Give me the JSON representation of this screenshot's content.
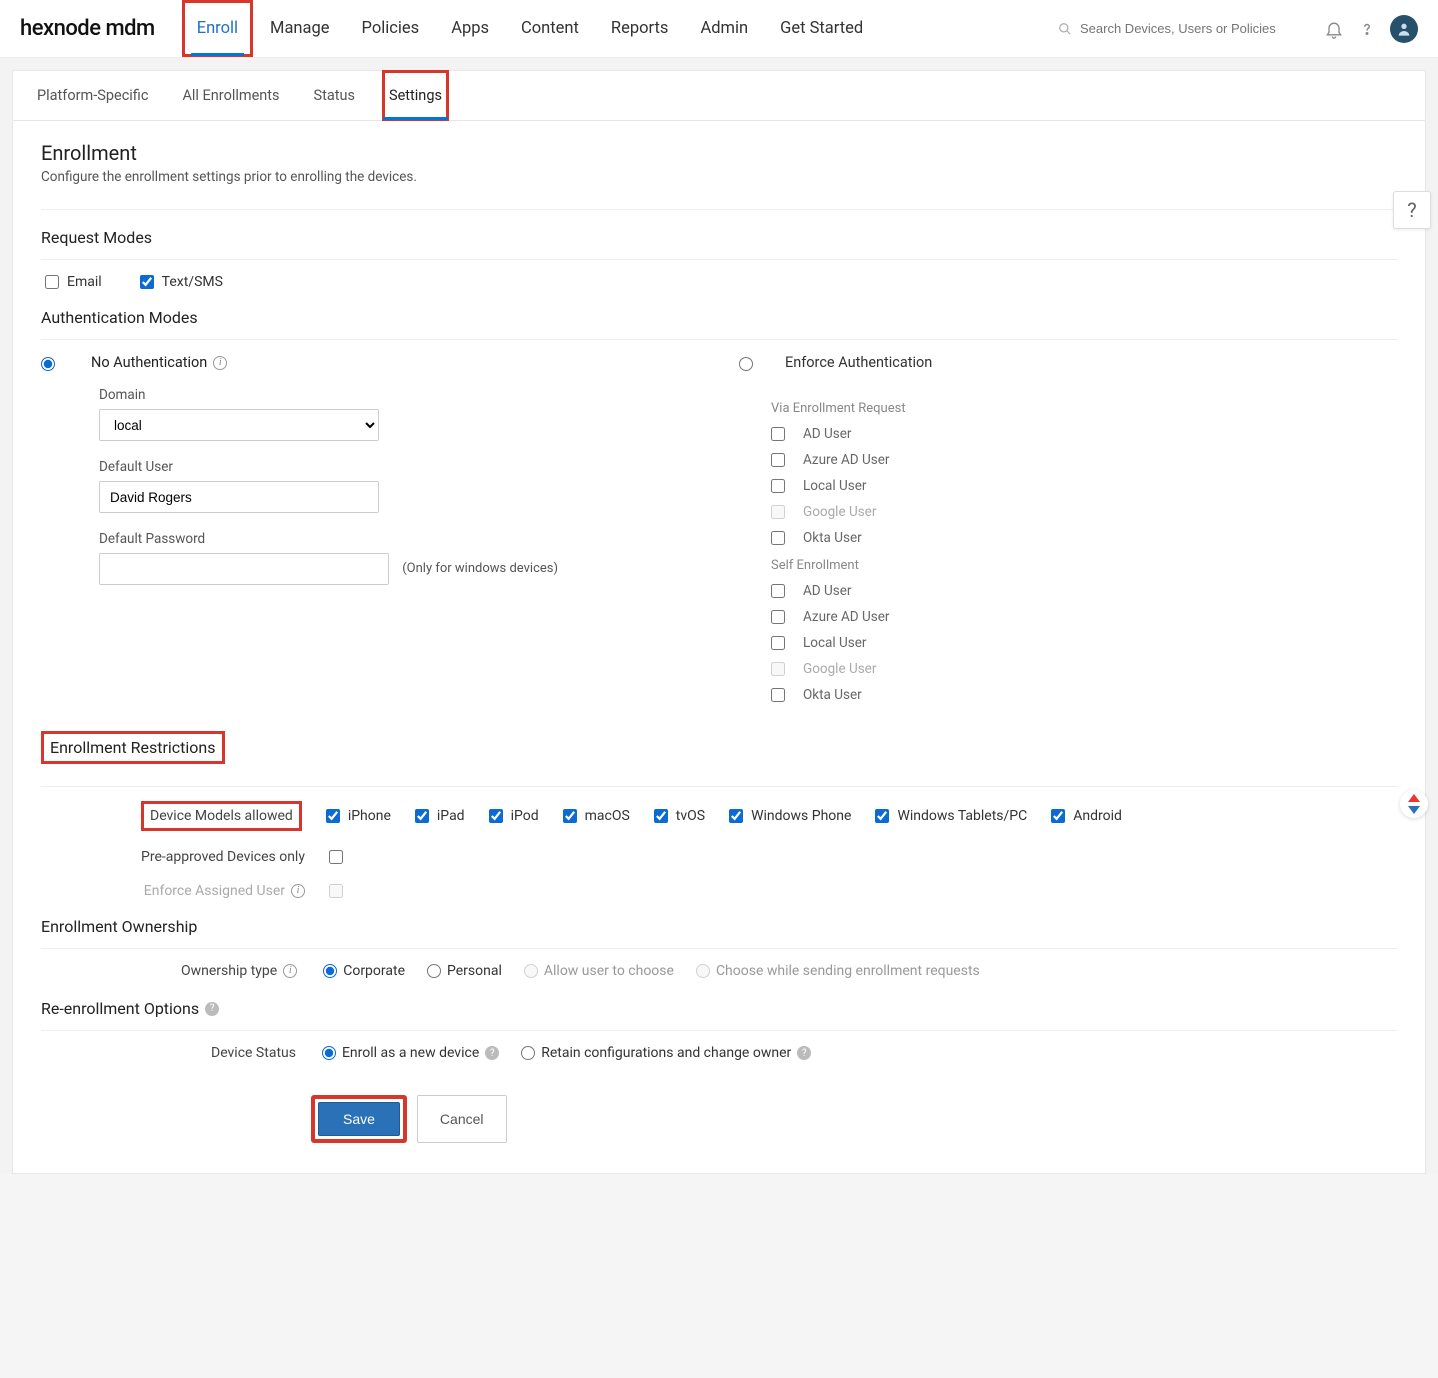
{
  "logo": "hexnode mdm",
  "top_nav": [
    "Enroll",
    "Manage",
    "Policies",
    "Apps",
    "Content",
    "Reports",
    "Admin",
    "Get Started"
  ],
  "top_nav_active_index": 0,
  "search": {
    "placeholder": "Search Devices, Users or Policies"
  },
  "sub_tabs": [
    "Platform-Specific",
    "All Enrollments",
    "Status",
    "Settings"
  ],
  "sub_tab_active_index": 3,
  "page_title": "Enrollment",
  "page_subtitle": "Configure the enrollment settings prior to enrolling the devices.",
  "sections": {
    "request_modes": {
      "title": "Request Modes",
      "options": [
        {
          "label": "Email",
          "checked": false
        },
        {
          "label": "Text/SMS",
          "checked": true
        }
      ]
    },
    "auth_modes": {
      "title": "Authentication Modes",
      "no_auth": {
        "label": "No Authentication",
        "selected": true,
        "domain": {
          "label": "Domain",
          "value": "local"
        },
        "default_user": {
          "label": "Default User",
          "value": "David Rogers"
        },
        "default_password": {
          "label": "Default Password",
          "value": "",
          "hint": "(Only for windows devices)"
        }
      },
      "enforce_auth": {
        "label": "Enforce Authentication",
        "selected": false,
        "via_label": "Via Enrollment Request",
        "via_items": [
          {
            "label": "AD User",
            "checked": false,
            "disabled": false
          },
          {
            "label": "Azure AD User",
            "checked": false,
            "disabled": false
          },
          {
            "label": "Local User",
            "checked": false,
            "disabled": false
          },
          {
            "label": "Google User",
            "checked": false,
            "disabled": true
          },
          {
            "label": "Okta User",
            "checked": false,
            "disabled": false
          }
        ],
        "self_label": "Self Enrollment",
        "self_items": [
          {
            "label": "AD User",
            "checked": false,
            "disabled": false
          },
          {
            "label": "Azure AD User",
            "checked": false,
            "disabled": false
          },
          {
            "label": "Local User",
            "checked": false,
            "disabled": false
          },
          {
            "label": "Google User",
            "checked": false,
            "disabled": true
          },
          {
            "label": "Okta User",
            "checked": false,
            "disabled": false
          }
        ]
      }
    },
    "restrictions": {
      "title": "Enrollment Restrictions",
      "device_models_label": "Device Models allowed",
      "device_models": [
        {
          "label": "iPhone",
          "checked": true
        },
        {
          "label": "iPad",
          "checked": true
        },
        {
          "label": "iPod",
          "checked": true
        },
        {
          "label": "macOS",
          "checked": true
        },
        {
          "label": "tvOS",
          "checked": true
        },
        {
          "label": "Windows Phone",
          "checked": true
        },
        {
          "label": "Windows Tablets/PC",
          "checked": true
        },
        {
          "label": "Android",
          "checked": true
        }
      ],
      "pre_approved": {
        "label": "Pre-approved Devices only",
        "checked": false
      },
      "enforce_assigned": {
        "label": "Enforce Assigned User",
        "checked": false,
        "disabled": true
      }
    },
    "ownership": {
      "title": "Enrollment Ownership",
      "label": "Ownership type",
      "options": [
        {
          "label": "Corporate",
          "checked": true,
          "disabled": false
        },
        {
          "label": "Personal",
          "checked": false,
          "disabled": false
        },
        {
          "label": "Allow user to choose",
          "checked": false,
          "disabled": true
        },
        {
          "label": "Choose while sending enrollment requests",
          "checked": false,
          "disabled": true
        }
      ]
    },
    "reenroll": {
      "title": "Re-enrollment Options",
      "label": "Device Status",
      "options": [
        {
          "label": "Enroll as a new device",
          "checked": true
        },
        {
          "label": "Retain configurations and change owner",
          "checked": false
        }
      ]
    }
  },
  "buttons": {
    "save": "Save",
    "cancel": "Cancel"
  }
}
